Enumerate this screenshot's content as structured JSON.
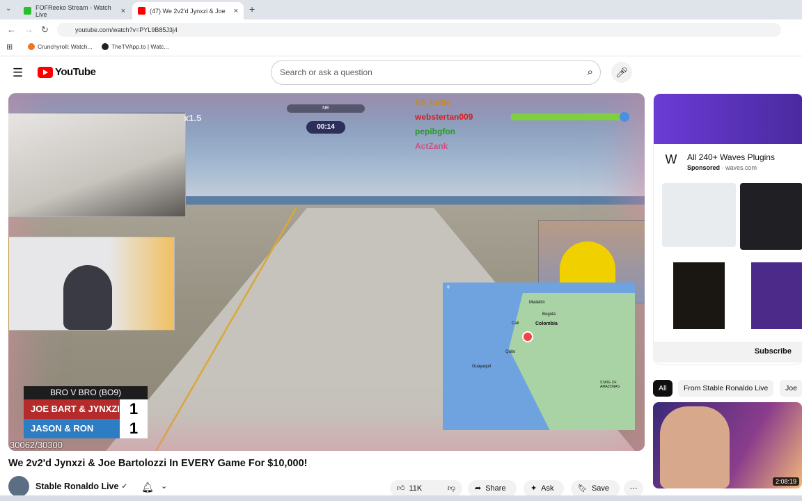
{
  "browser": {
    "tabs": [
      {
        "title": "FOFReeko Stream - Watch Live",
        "favicon_color": "#25c02a"
      },
      {
        "title": "(47) We 2v2'd Jynxzi & Joe",
        "favicon_color": "#ff0000"
      }
    ],
    "url": "youtube.com/watch?v=PYL9B85J3j4",
    "bookmarks": [
      "Crunchyroll: Watch...",
      "TheTVApp.to | Watc..."
    ]
  },
  "header": {
    "logo_text": "YouTube",
    "search_placeholder": "Search or ask a question"
  },
  "video": {
    "compass_label": "NE",
    "timer": "00:14",
    "speed_label": "x1.5",
    "chat": [
      {
        "name": "V3_turtle",
        "color": "#c18a2a"
      },
      {
        "name": "webstertan009",
        "color": "#d02020"
      },
      {
        "name": "pepibgfon",
        "color": "#2a9a2a"
      },
      {
        "name": "ActZank",
        "color": "#d05080"
      }
    ],
    "map_labels": [
      "Medellín",
      "Bogotá",
      "Cali",
      "Colombia",
      "Quito",
      "Guayaquil",
      "STATE OF AMAZONAS"
    ],
    "scoreboard": {
      "header": "BRO V BRO (BO9)",
      "rows": [
        {
          "team": "JOE BART & JYNXZI",
          "score": "1",
          "color": "#b52a2a"
        },
        {
          "team": "JASON & RON",
          "score": "1",
          "color": "#2c7dc4"
        }
      ]
    },
    "viewer_text": "30062/30300"
  },
  "below": {
    "title": "We 2v2'd Jynxzi & Joe Bartolozzi In EVERY Game For $10,000!",
    "channel": "Stable Ronaldo Live",
    "likes": "11K",
    "share": "Share",
    "ask": "Ask",
    "save": "Save"
  },
  "sidebar": {
    "ad_title": "All 240+ Waves Plugins",
    "ad_sponsored": "Sponsored",
    "ad_domain": "waves.com",
    "ad_button": "Subscribe",
    "chips": [
      "All",
      "From Stable Ronaldo Live",
      "Joe B"
    ],
    "thumb_duration": "2:08:19"
  }
}
